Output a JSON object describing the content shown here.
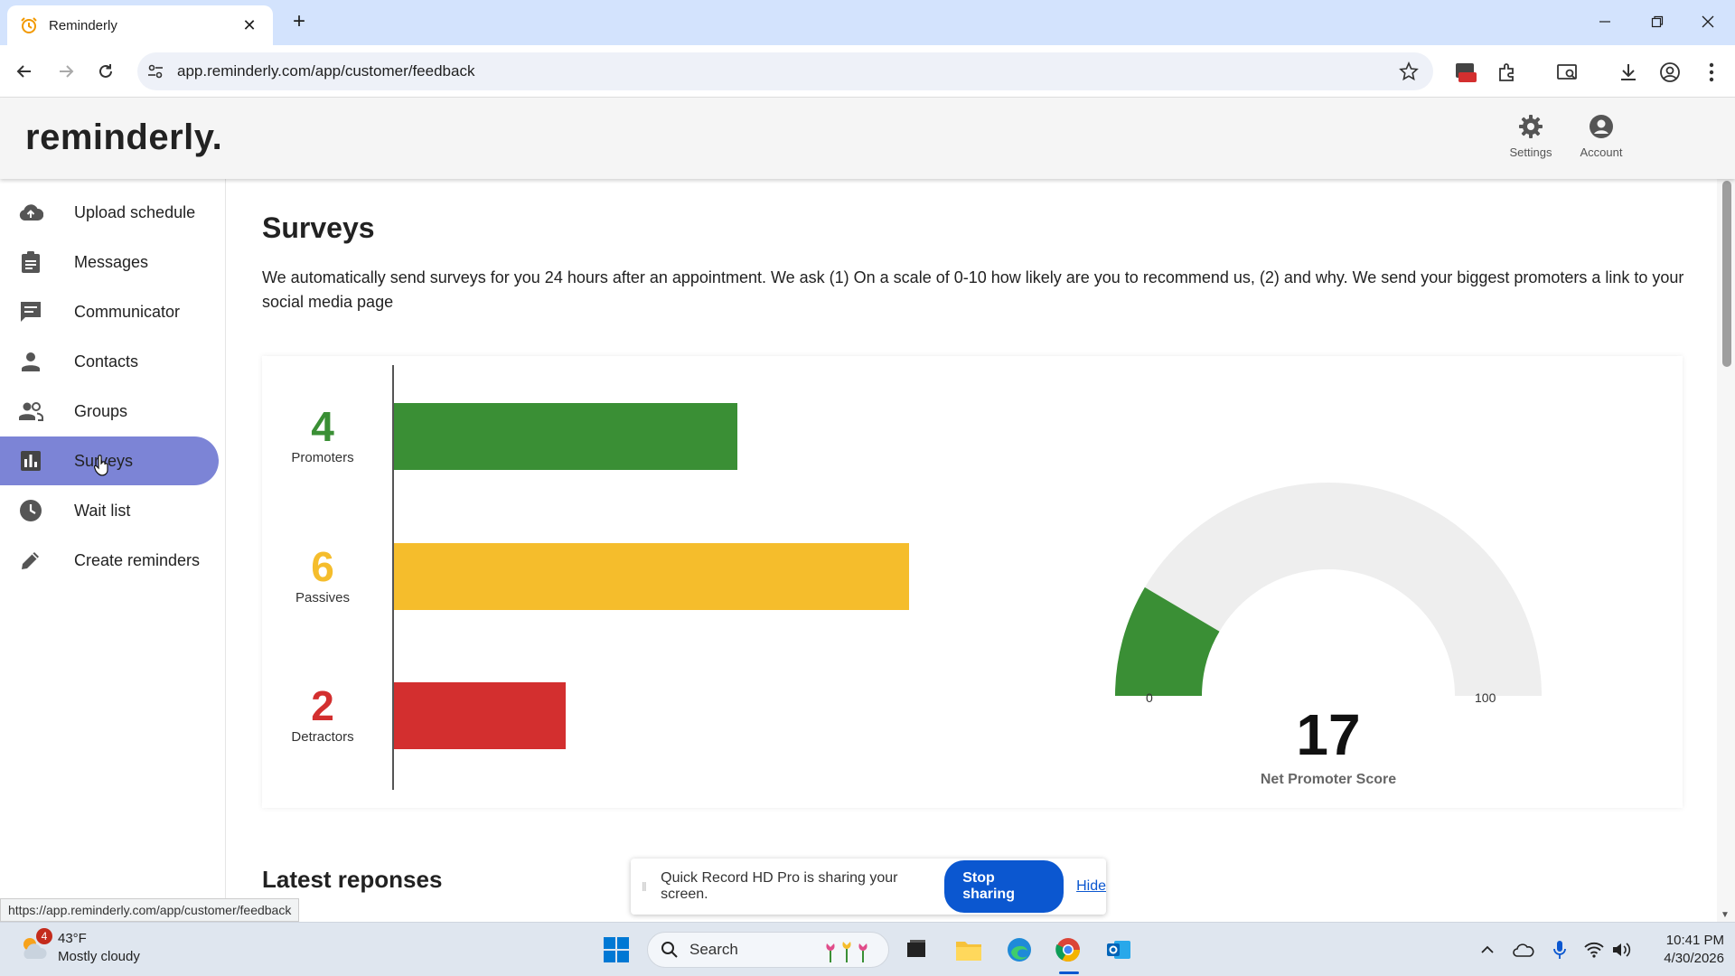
{
  "browser": {
    "tab_title": "Reminderly",
    "url": "app.reminderly.com/app/customer/feedback",
    "status_url": "https://app.reminderly.com/app/customer/feedback"
  },
  "header": {
    "logo": "reminderly.",
    "settings_label": "Settings",
    "account_label": "Account"
  },
  "sidebar": {
    "items": [
      {
        "label": "Upload schedule",
        "icon": "cloud-upload-icon"
      },
      {
        "label": "Messages",
        "icon": "clipboard-icon"
      },
      {
        "label": "Communicator",
        "icon": "chat-icon"
      },
      {
        "label": "Contacts",
        "icon": "person-icon"
      },
      {
        "label": "Groups",
        "icon": "group-icon"
      },
      {
        "label": "Surveys",
        "icon": "bar-chart-icon",
        "active": true
      },
      {
        "label": "Wait list",
        "icon": "clock-icon"
      },
      {
        "label": "Create reminders",
        "icon": "pencil-icon"
      }
    ]
  },
  "main": {
    "title": "Surveys",
    "description": "We automatically send surveys for you 24 hours after an appointment. We ask (1) On a scale of 0-10 how likely are you to recommend us, (2) and why. We send your biggest promoters a link to your social media page",
    "latest_title": "Latest reponses"
  },
  "chart_data": [
    {
      "type": "bar",
      "categories": [
        "Promoters",
        "Passives",
        "Detractors"
      ],
      "values": [
        4,
        6,
        2
      ],
      "colors": [
        "#3a8f35",
        "#f5bd2c",
        "#d32f2f"
      ]
    },
    {
      "type": "gauge",
      "value": 17,
      "min": 0,
      "max": 100,
      "min_label": "0",
      "max_label": "100",
      "value_label": "17",
      "label": "Net Promoter Score",
      "fill_color": "#3a8f35",
      "track_color": "#eeeeee"
    }
  ],
  "share_bar": {
    "text": "Quick Record HD Pro is sharing your screen.",
    "stop_label": "Stop sharing",
    "hide_label": "Hide"
  },
  "taskbar": {
    "weather_temp": "43°F",
    "weather_desc": "Mostly cloudy",
    "weather_badge": "4",
    "search_label": "Search",
    "time": "10:41 PM",
    "date": "4/30/2026"
  }
}
